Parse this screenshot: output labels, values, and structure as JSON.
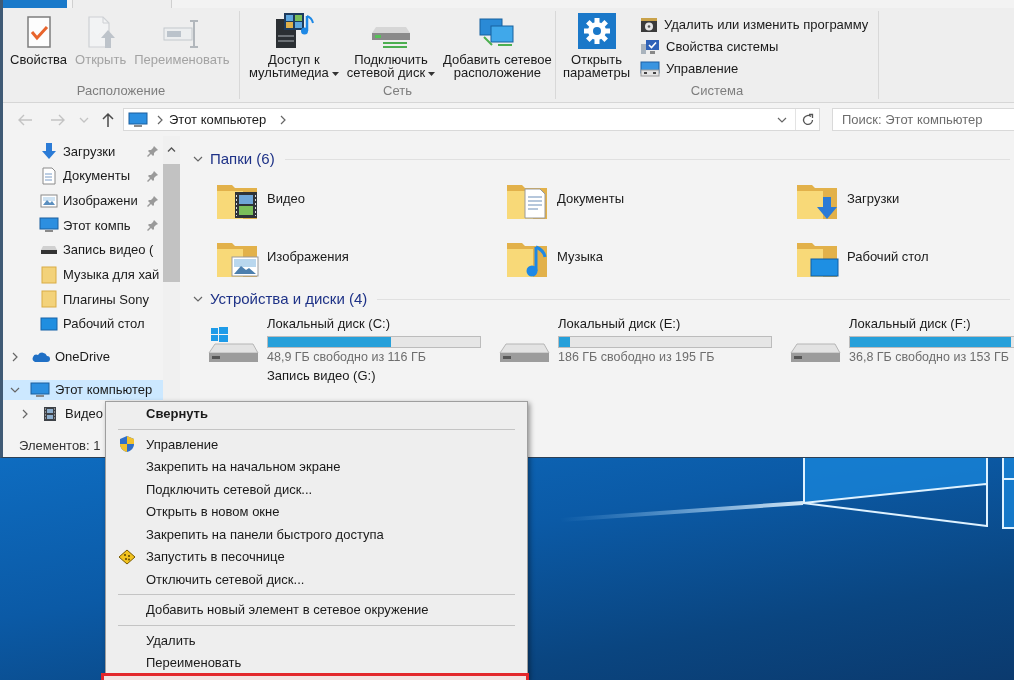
{
  "ribbon_tabs": [
    {
      "kind": "file",
      "selected": false
    },
    {
      "kind": "tab",
      "selected": true
    }
  ],
  "ribbon": {
    "groups": [
      {
        "label": "Расположение",
        "buttons": [
          {
            "kind": "large",
            "label": [
              "Свойства"
            ],
            "disabled": false,
            "dropdown": false
          },
          {
            "kind": "large",
            "label": [
              "Открыть"
            ],
            "disabled": true,
            "dropdown": false
          },
          {
            "kind": "large",
            "label": [
              "Переименовать"
            ],
            "disabled": true,
            "dropdown": false
          }
        ]
      },
      {
        "label": "Сеть",
        "buttons": [
          {
            "kind": "large",
            "label": [
              "Доступ к",
              "мультимедиа"
            ],
            "disabled": false,
            "dropdown": true
          },
          {
            "kind": "large",
            "label": [
              "Подключить",
              "сетевой диск"
            ],
            "disabled": false,
            "dropdown": true
          },
          {
            "kind": "large",
            "label": [
              "Добавить сетевое",
              "расположение"
            ],
            "disabled": false,
            "dropdown": false
          }
        ]
      },
      {
        "label": "Система",
        "buttons": [
          {
            "kind": "large",
            "label": [
              "Открыть",
              "параметры"
            ],
            "disabled": false,
            "dropdown": false
          },
          {
            "kind": "small",
            "label": [
              "Удалить или изменить программу"
            ],
            "disabled": false,
            "dropdown": false
          },
          {
            "kind": "small",
            "label": [
              "Свойства системы"
            ],
            "disabled": false,
            "dropdown": false
          },
          {
            "kind": "small",
            "label": [
              "Управление"
            ],
            "disabled": false,
            "dropdown": false
          }
        ]
      }
    ]
  },
  "address_bar": {
    "nav_buttons": [
      {
        "kind": "back",
        "disabled": true
      },
      {
        "kind": "forward",
        "disabled": true
      },
      {
        "kind": "recent",
        "disabled": true
      },
      {
        "kind": "up",
        "disabled": false
      }
    ],
    "path": [
      "Этот компьютер"
    ]
  },
  "search": {
    "placeholder": "Поиск: Этот компьютер"
  },
  "nav_pane": {
    "quick_access": [
      {
        "label": "Загрузки",
        "pinned": true,
        "selected": false
      },
      {
        "label": "Документы",
        "pinned": true,
        "selected": false
      },
      {
        "label": "Изображени",
        "pinned": true,
        "selected": false
      },
      {
        "label": "Этот компь",
        "pinned": true,
        "selected": false
      },
      {
        "label": "Запись видео (",
        "pinned": false,
        "selected": false
      },
      {
        "label": "Музыка для хай",
        "pinned": false,
        "selected": false
      },
      {
        "label": "Плагины Sony",
        "pinned": false,
        "selected": false
      },
      {
        "label": "Рабочий стол",
        "pinned": false,
        "selected": false
      }
    ],
    "tree": [
      {
        "label": "OneDrive",
        "expanded": false,
        "selected": false
      },
      {
        "label": "Этот компьютер",
        "expanded": true,
        "selected": true,
        "children": [
          {
            "label": "Видео",
            "expanded": false,
            "selected": false
          }
        ]
      }
    ]
  },
  "content": {
    "sections": [
      {
        "kind": "folders",
        "title": "Папки (6)",
        "expanded": true,
        "items": [
          {
            "label": "Видео"
          },
          {
            "label": "Документы"
          },
          {
            "label": "Загрузки"
          },
          {
            "label": "Изображения"
          },
          {
            "label": "Музыка"
          },
          {
            "label": "Рабочий стол"
          }
        ]
      },
      {
        "kind": "drives",
        "title": "Устройства и диски (4)",
        "expanded": true,
        "items": [
          {
            "name": "Локальный диск (C:)",
            "level": 0.58,
            "free": "48,9 ГБ свободно из 116 ГБ"
          },
          {
            "name": "Локальный диск (E:)",
            "level": 0.05,
            "free": "186 ГБ свободно из 195 ГБ"
          },
          {
            "name": "Локальный диск (F:)",
            "level": 0.76,
            "free": "36,8 ГБ свободно из 153 ГБ"
          },
          {
            "name": "Запись видео (G:)"
          }
        ]
      }
    ]
  },
  "status_bar": {
    "text": "Элементов: 1"
  },
  "context_menu": {
    "items": [
      {
        "kind": "item",
        "label": "Свернуть",
        "default": true
      },
      {
        "kind": "separator"
      },
      {
        "kind": "item",
        "label": "Управление",
        "default": false
      },
      {
        "kind": "item",
        "label": "Закрепить на начальном экране",
        "default": false
      },
      {
        "kind": "item",
        "label": "Подключить сетевой диск...",
        "default": false
      },
      {
        "kind": "item",
        "label": "Открыть в новом окне",
        "default": false
      },
      {
        "kind": "item",
        "label": "Закрепить на панели быстрого доступа",
        "default": false
      },
      {
        "kind": "item",
        "label": "Запустить в песочнице",
        "default": false
      },
      {
        "kind": "item",
        "label": "Отключить сетевой диск...",
        "default": false
      },
      {
        "kind": "separator"
      },
      {
        "kind": "item",
        "label": "Добавить новый элемент в сетевое окружение",
        "default": false
      },
      {
        "kind": "separator"
      },
      {
        "kind": "item",
        "label": "Удалить",
        "default": false
      },
      {
        "kind": "item",
        "label": "Переименовать",
        "default": false
      }
    ]
  }
}
